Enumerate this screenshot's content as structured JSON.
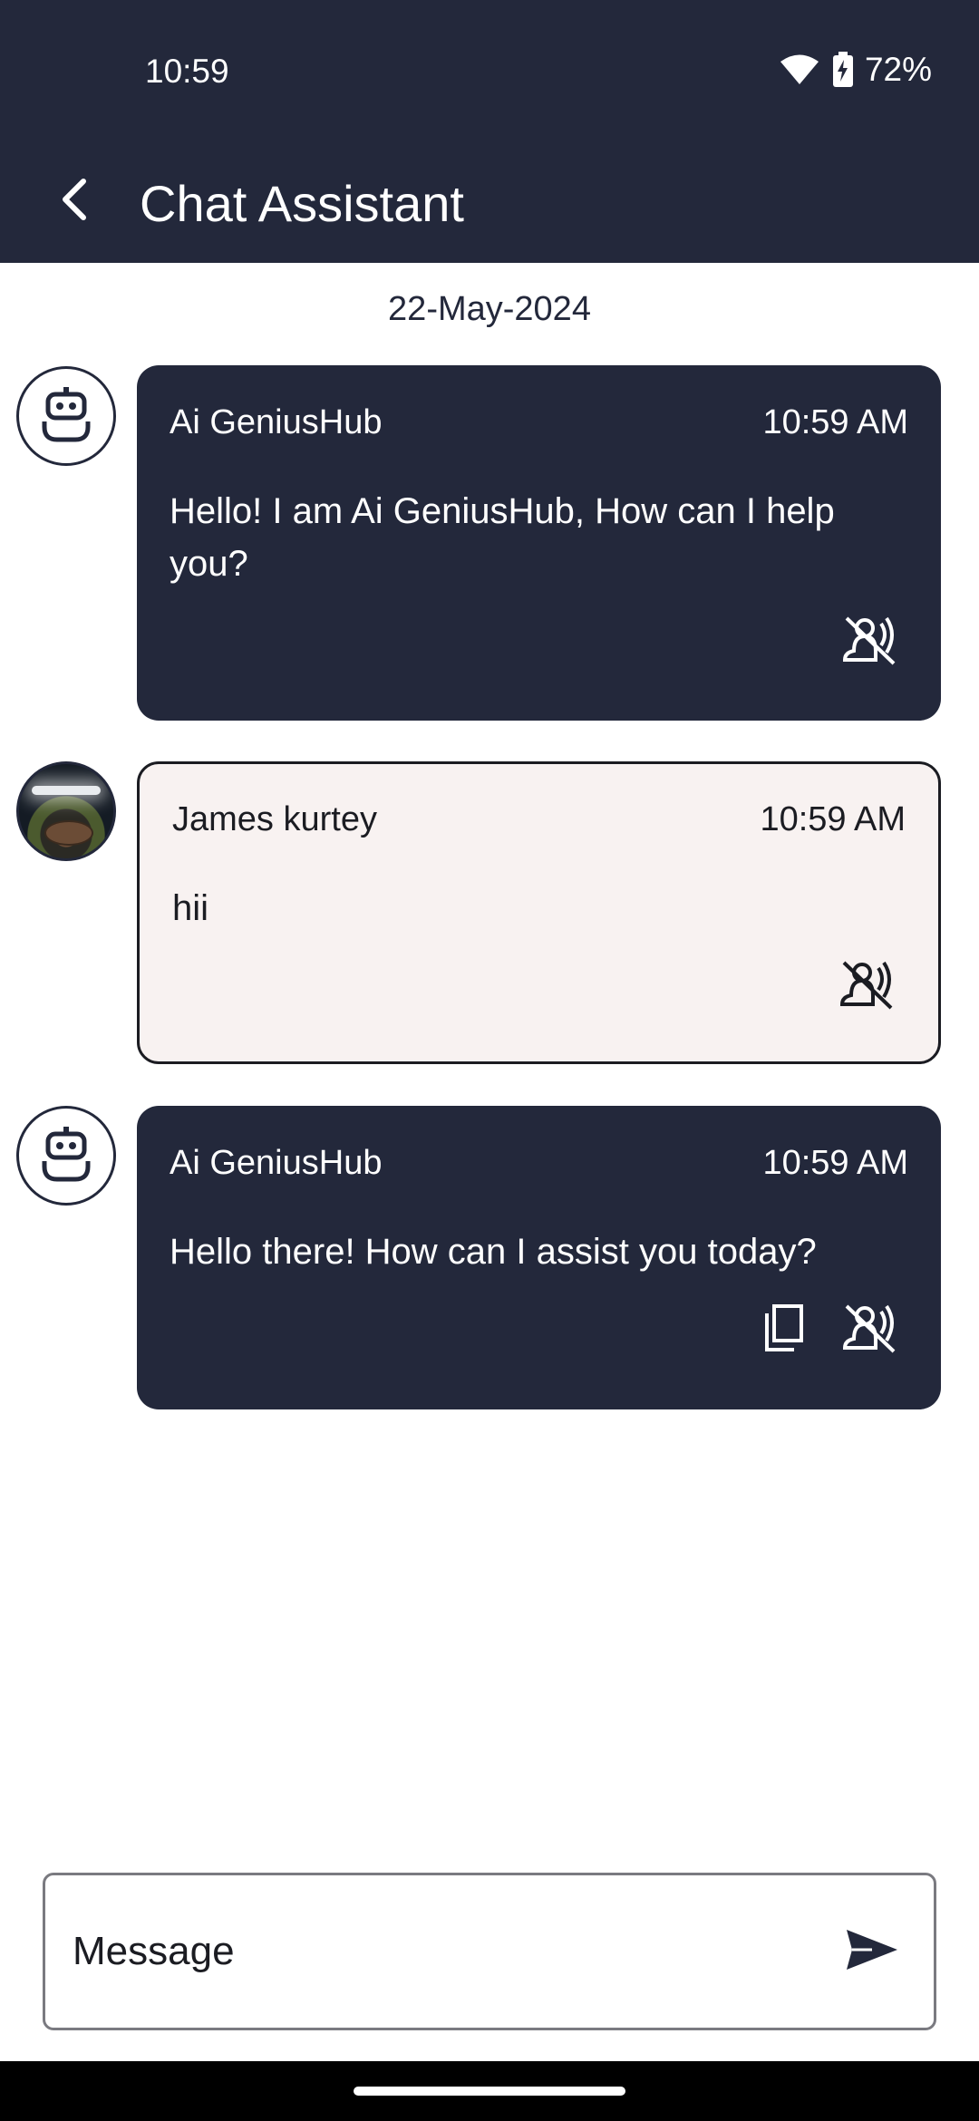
{
  "status_bar": {
    "time": "10:59",
    "battery": "72%",
    "icons": [
      "wifi-icon",
      "battery-charging-icon"
    ]
  },
  "app_bar": {
    "title": "Chat Assistant",
    "back_icon": "arrow-back-icon"
  },
  "chat": {
    "date": "22-May-2024",
    "messages": [
      {
        "sender": "Ai GeniusHub",
        "time": "10:59 AM",
        "text": "Hello! I am Ai GeniusHub, How can I help you?",
        "avatar": "robot-icon"
      },
      {
        "sender": "James kurtey",
        "time": "10:59 AM",
        "text": "hii",
        "avatar": "user-photo"
      },
      {
        "sender": "Ai GeniusHub",
        "time": "10:59 AM",
        "text": "Hello there! How can I assist you today?",
        "avatar": "robot-icon"
      }
    ]
  },
  "composer": {
    "placeholder": "Message",
    "value": "",
    "send_icon": "send-icon"
  },
  "colors": {
    "primary": "#23283b",
    "user_bubble": "#f8f2f1",
    "text_dark": "#1b1c22"
  }
}
